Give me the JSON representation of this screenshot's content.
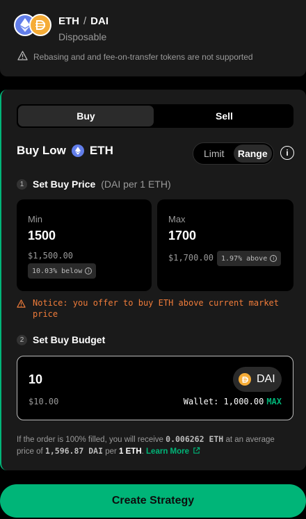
{
  "pair": {
    "base": "ETH",
    "separator": "/",
    "quote": "DAI",
    "type": "Disposable"
  },
  "warning": "Rebasing and and fee-on-transfer tokens are not supported",
  "tabs": [
    {
      "label": "Buy",
      "active": true
    },
    {
      "label": "Sell",
      "active": false
    }
  ],
  "title": {
    "prefix": "Buy Low",
    "token": "ETH"
  },
  "mode": {
    "limit": "Limit",
    "range": "Range",
    "selected": "Range"
  },
  "step1": {
    "num": "1",
    "label": "Set Buy Price",
    "hint": "(DAI per 1 ETH)"
  },
  "min": {
    "caption": "Min",
    "value": "1500",
    "fiat": "$1,500.00",
    "badge": "10.03% below"
  },
  "max": {
    "caption": "Max",
    "value": "1700",
    "fiat": "$1,700.00",
    "badge": "1.97% above"
  },
  "notice": "Notice: you offer to buy ETH above current market price",
  "step2": {
    "num": "2",
    "label": "Set Buy Budget"
  },
  "budget": {
    "value": "10",
    "fiat": "$10.00",
    "token": "DAI",
    "wallet": "Wallet: 1,000.00",
    "max": "MAX"
  },
  "fill_note": {
    "part1": "If the order is 100% filled, you will receive",
    "receive": "0.006262 ETH",
    "part2": "at an average price of",
    "avg": "1,596.87 DAI",
    "part3": "per",
    "per": "1 ETH",
    "link": "Learn More"
  },
  "cta": "Create Strategy",
  "colors": {
    "accent": "#00b578",
    "notice": "#f07c3a",
    "eth": "#627eea",
    "dai": "#f5ac37"
  }
}
